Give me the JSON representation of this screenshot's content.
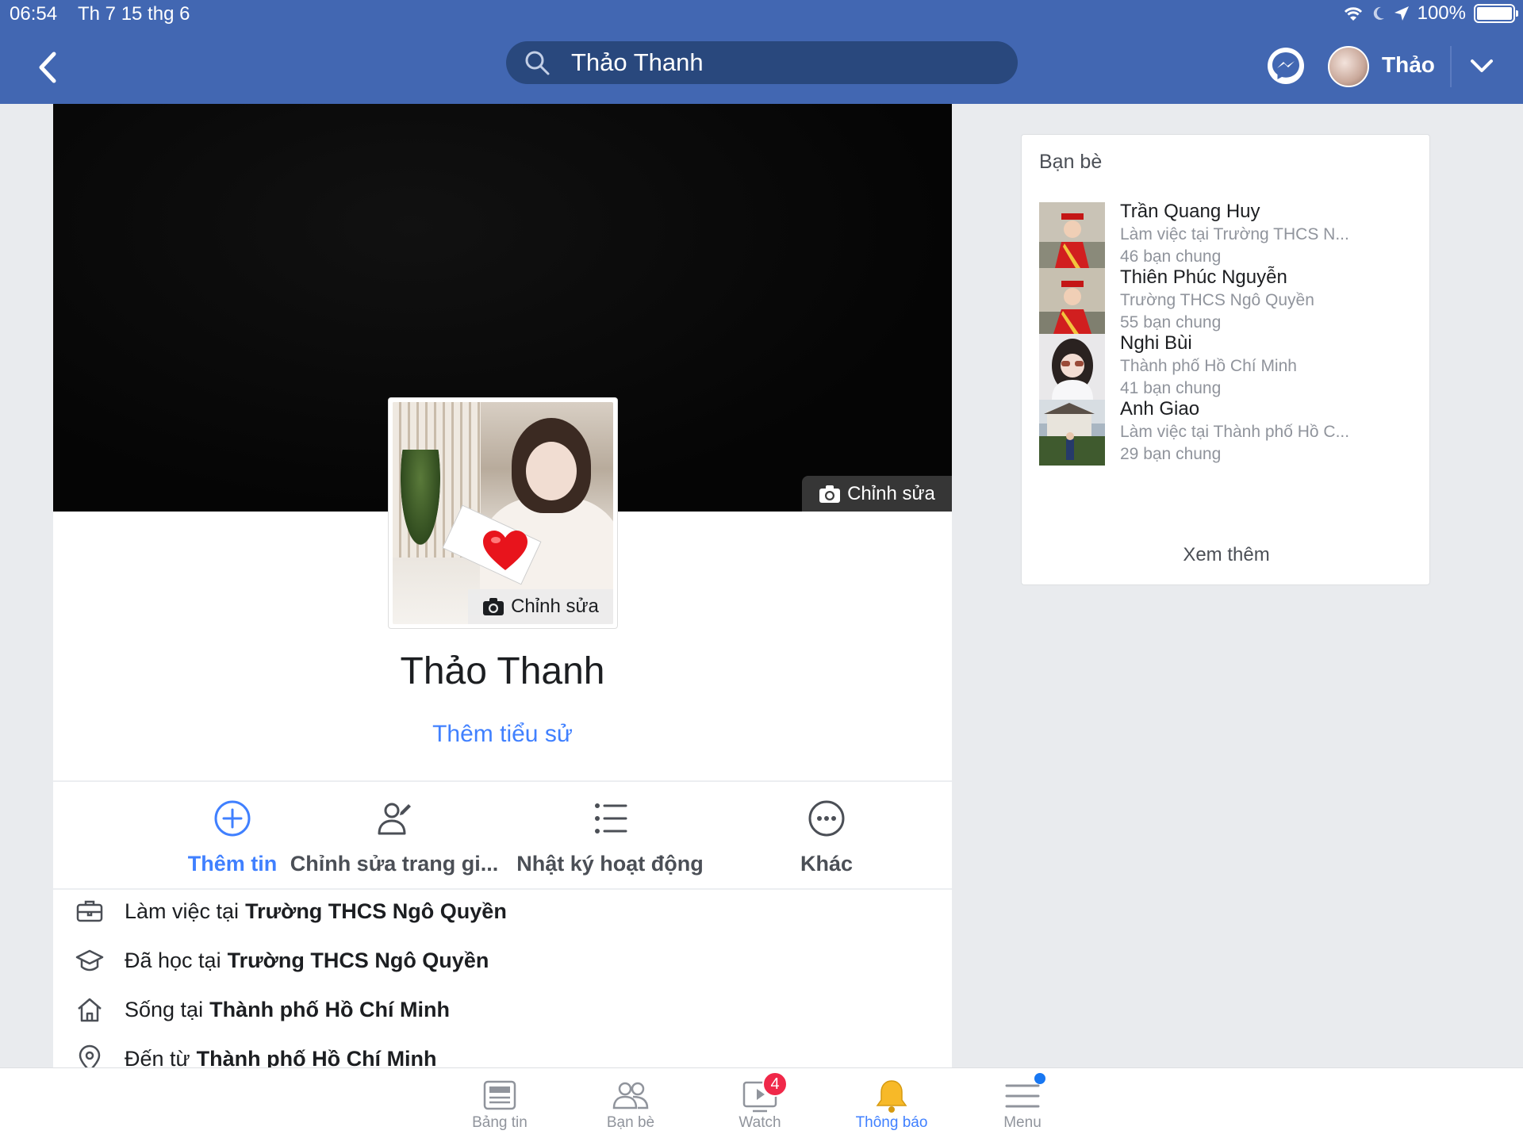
{
  "status_bar": {
    "time": "06:54",
    "date": "Th 7 15 thg 6",
    "battery": "100%"
  },
  "header": {
    "search_text": "Thảo Thanh",
    "user_name": "Thảo"
  },
  "cover": {
    "edit_label": "Chỉnh sửa"
  },
  "avatar": {
    "edit_label": "Chỉnh sửa"
  },
  "profile": {
    "name": "Thảo Thanh",
    "add_bio": "Thêm tiểu sử"
  },
  "actions": [
    {
      "label": "Thêm tin",
      "icon": "plus-circle-icon"
    },
    {
      "label": "Chỉnh sửa trang gi...",
      "icon": "edit-person-icon"
    },
    {
      "label": "Nhật ký hoạt động",
      "icon": "list-icon"
    },
    {
      "label": "Khác",
      "icon": "more-icon"
    }
  ],
  "about": [
    {
      "prefix": "Làm việc tại",
      "value": "Trường THCS Ngô Quyền",
      "icon": "briefcase-icon"
    },
    {
      "prefix": "Đã học tại",
      "value": "Trường THCS Ngô Quyền",
      "icon": "graduation-cap-icon"
    },
    {
      "prefix": "Sống tại",
      "value": "Thành phố Hồ Chí Minh",
      "icon": "home-icon"
    },
    {
      "prefix": "Đến từ",
      "value": "Thành phố Hồ Chí Minh",
      "icon": "location-pin-icon"
    }
  ],
  "friends": {
    "title": "Bạn bè",
    "items": [
      {
        "name": "Trần Quang Huy",
        "subtitle": "Làm việc tại Trường THCS N...",
        "mutual": "46 bạn chung"
      },
      {
        "name": "Thiên Phúc Nguyễn",
        "subtitle": "Trường THCS Ngô Quyền",
        "mutual": "55 bạn chung"
      },
      {
        "name": "Nghi Bùi",
        "subtitle": "Thành phố Hồ Chí Minh",
        "mutual": "41 bạn chung"
      },
      {
        "name": "Anh Giao",
        "subtitle": "Làm việc tại Thành phố Hồ C...",
        "mutual": "29 bạn chung"
      }
    ],
    "see_more": "Xem thêm"
  },
  "bottom_nav": [
    {
      "label": "Bảng tin",
      "icon": "news-feed-icon"
    },
    {
      "label": "Bạn bè",
      "icon": "friends-icon"
    },
    {
      "label": "Watch",
      "icon": "watch-icon",
      "badge": "4"
    },
    {
      "label": "Thông báo",
      "icon": "bell-icon",
      "active": true
    },
    {
      "label": "Menu",
      "icon": "menu-icon"
    }
  ],
  "colors": {
    "brand": "#4267b2",
    "accent": "#4080ff",
    "badge": "#f02849"
  }
}
